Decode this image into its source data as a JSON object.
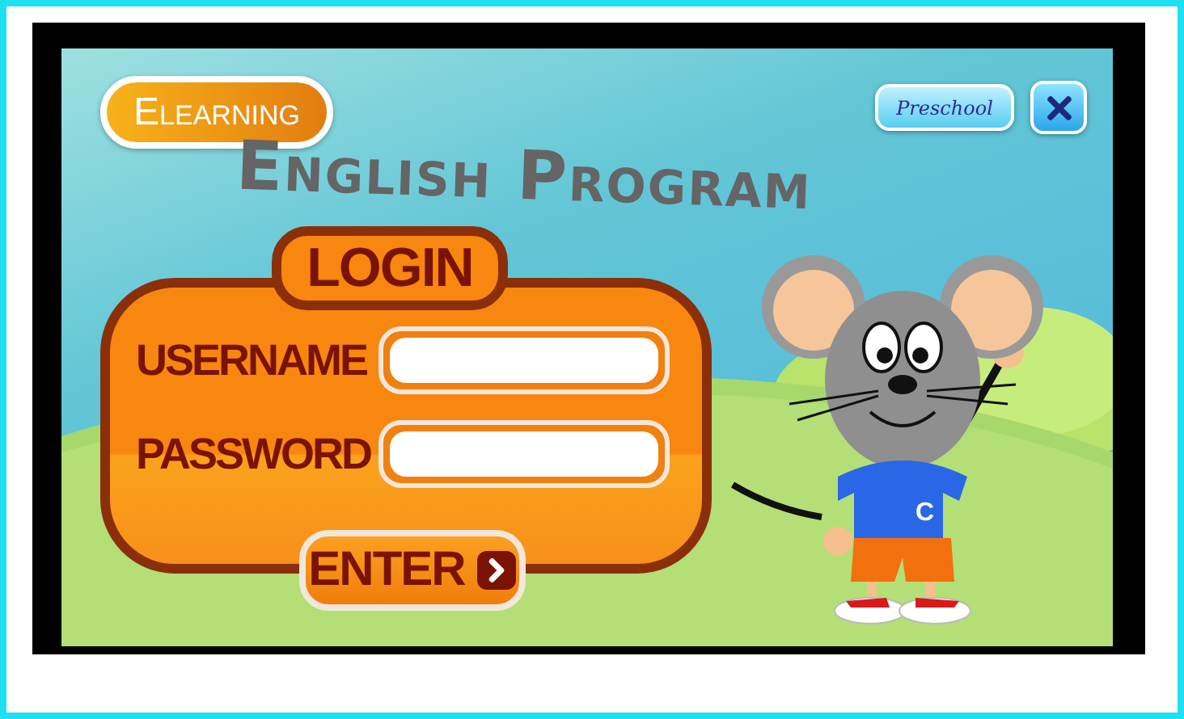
{
  "brand_badge": "Elearning",
  "title": "English Program",
  "level_button": "Preschool",
  "login": {
    "heading": "LOGIN",
    "fields": [
      {
        "label": "USERNAME"
      },
      {
        "label": "PASSWORD"
      }
    ],
    "submit": "ENTER"
  },
  "mascot": {
    "shirt_letter": "C"
  }
}
